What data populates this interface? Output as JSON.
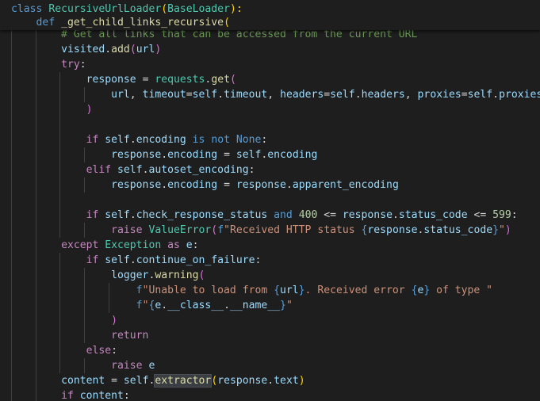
{
  "editor": {
    "sticky": [
      [
        [
          "kw",
          "class "
        ],
        [
          "cls",
          "RecursiveUrlLoader"
        ],
        [
          "yellow",
          "("
        ],
        [
          "cls",
          "BaseLoader"
        ],
        [
          "yellow",
          "):"
        ]
      ],
      [
        [
          "t",
          "    "
        ],
        [
          "kw",
          "def "
        ],
        [
          "fn",
          "_get_child_links_recursive"
        ],
        [
          "yellow",
          "("
        ]
      ]
    ],
    "lines": [
      [
        [
          "t",
          "        "
        ],
        [
          "cmt",
          "# Get all links that can be accessed from the current URL"
        ]
      ],
      [
        [
          "t",
          "        "
        ],
        [
          "var",
          "visited"
        ],
        [
          "t",
          "."
        ],
        [
          "fn",
          "add"
        ],
        [
          "paren",
          "("
        ],
        [
          "var",
          "url"
        ],
        [
          "paren",
          ")"
        ]
      ],
      [
        [
          "t",
          "        "
        ],
        [
          "ctrl",
          "try"
        ],
        [
          "t",
          ":"
        ]
      ],
      [
        [
          "t",
          "            "
        ],
        [
          "var",
          "response"
        ],
        [
          "t",
          " = "
        ],
        [
          "cls",
          "requests"
        ],
        [
          "t",
          "."
        ],
        [
          "fn",
          "get"
        ],
        [
          "paren",
          "("
        ]
      ],
      [
        [
          "t",
          "                "
        ],
        [
          "var",
          "url"
        ],
        [
          "t",
          ", "
        ],
        [
          "var",
          "timeout"
        ],
        [
          "t",
          "="
        ],
        [
          "var",
          "self"
        ],
        [
          "t",
          "."
        ],
        [
          "var",
          "timeout"
        ],
        [
          "t",
          ", "
        ],
        [
          "var",
          "headers"
        ],
        [
          "t",
          "="
        ],
        [
          "var",
          "self"
        ],
        [
          "t",
          "."
        ],
        [
          "var",
          "headers"
        ],
        [
          "t",
          ", "
        ],
        [
          "var",
          "proxies"
        ],
        [
          "t",
          "="
        ],
        [
          "var",
          "self"
        ],
        [
          "t",
          "."
        ],
        [
          "var",
          "proxies"
        ]
      ],
      [
        [
          "t",
          "            "
        ],
        [
          "paren",
          ")"
        ]
      ],
      [],
      [
        [
          "t",
          "            "
        ],
        [
          "ctrl",
          "if "
        ],
        [
          "var",
          "self"
        ],
        [
          "t",
          "."
        ],
        [
          "var",
          "encoding"
        ],
        [
          "t",
          " "
        ],
        [
          "kw",
          "is not"
        ],
        [
          "t",
          " "
        ],
        [
          "kw",
          "None"
        ],
        [
          "t",
          ":"
        ]
      ],
      [
        [
          "t",
          "                "
        ],
        [
          "var",
          "response"
        ],
        [
          "t",
          "."
        ],
        [
          "var",
          "encoding"
        ],
        [
          "t",
          " = "
        ],
        [
          "var",
          "self"
        ],
        [
          "t",
          "."
        ],
        [
          "var",
          "encoding"
        ]
      ],
      [
        [
          "t",
          "            "
        ],
        [
          "ctrl",
          "elif "
        ],
        [
          "var",
          "self"
        ],
        [
          "t",
          "."
        ],
        [
          "var",
          "autoset_encoding"
        ],
        [
          "t",
          ":"
        ]
      ],
      [
        [
          "t",
          "                "
        ],
        [
          "var",
          "response"
        ],
        [
          "t",
          "."
        ],
        [
          "var",
          "encoding"
        ],
        [
          "t",
          " = "
        ],
        [
          "var",
          "response"
        ],
        [
          "t",
          "."
        ],
        [
          "var",
          "apparent_encoding"
        ]
      ],
      [],
      [
        [
          "t",
          "            "
        ],
        [
          "ctrl",
          "if "
        ],
        [
          "var",
          "self"
        ],
        [
          "t",
          "."
        ],
        [
          "var",
          "check_response_status"
        ],
        [
          "t",
          " "
        ],
        [
          "kw",
          "and"
        ],
        [
          "t",
          " "
        ],
        [
          "num",
          "400"
        ],
        [
          "t",
          " <= "
        ],
        [
          "var",
          "response"
        ],
        [
          "t",
          "."
        ],
        [
          "var",
          "status_code"
        ],
        [
          "t",
          " <= "
        ],
        [
          "num",
          "599"
        ],
        [
          "t",
          ":"
        ]
      ],
      [
        [
          "t",
          "                "
        ],
        [
          "ctrl",
          "raise "
        ],
        [
          "cls",
          "ValueError"
        ],
        [
          "paren",
          "("
        ],
        [
          "kw",
          "f"
        ],
        [
          "str",
          "\"Received HTTP status "
        ],
        [
          "brace",
          "{"
        ],
        [
          "var",
          "response"
        ],
        [
          "t",
          "."
        ],
        [
          "var",
          "status_code"
        ],
        [
          "brace",
          "}"
        ],
        [
          "str",
          "\""
        ],
        [
          "paren",
          ")"
        ]
      ],
      [
        [
          "t",
          "        "
        ],
        [
          "ctrl",
          "except "
        ],
        [
          "cls",
          "Exception"
        ],
        [
          "t",
          " "
        ],
        [
          "ctrl",
          "as "
        ],
        [
          "var",
          "e"
        ],
        [
          "t",
          ":"
        ]
      ],
      [
        [
          "t",
          "            "
        ],
        [
          "ctrl",
          "if "
        ],
        [
          "var",
          "self"
        ],
        [
          "t",
          "."
        ],
        [
          "var",
          "continue_on_failure"
        ],
        [
          "t",
          ":"
        ]
      ],
      [
        [
          "t",
          "                "
        ],
        [
          "var",
          "logger"
        ],
        [
          "t",
          "."
        ],
        [
          "fn",
          "warning"
        ],
        [
          "paren",
          "("
        ]
      ],
      [
        [
          "t",
          "                    "
        ],
        [
          "kw",
          "f"
        ],
        [
          "str",
          "\"Unable to load from "
        ],
        [
          "brace",
          "{"
        ],
        [
          "var",
          "url"
        ],
        [
          "brace",
          "}"
        ],
        [
          "str",
          ". Received error "
        ],
        [
          "brace",
          "{"
        ],
        [
          "var",
          "e"
        ],
        [
          "brace",
          "}"
        ],
        [
          "str",
          " of type \""
        ]
      ],
      [
        [
          "t",
          "                    "
        ],
        [
          "kw",
          "f"
        ],
        [
          "str",
          "\""
        ],
        [
          "brace",
          "{"
        ],
        [
          "var",
          "e"
        ],
        [
          "t",
          "."
        ],
        [
          "var",
          "__class__"
        ],
        [
          "t",
          "."
        ],
        [
          "var",
          "__name__"
        ],
        [
          "brace",
          "}"
        ],
        [
          "str",
          "\""
        ]
      ],
      [
        [
          "t",
          "                "
        ],
        [
          "paren",
          ")"
        ]
      ],
      [
        [
          "t",
          "                "
        ],
        [
          "ctrl",
          "return"
        ]
      ],
      [
        [
          "t",
          "            "
        ],
        [
          "ctrl",
          "else"
        ],
        [
          "t",
          ":"
        ]
      ],
      [
        [
          "t",
          "                "
        ],
        [
          "ctrl",
          "raise "
        ],
        [
          "var",
          "e"
        ]
      ],
      [
        [
          "t",
          "        "
        ],
        [
          "var",
          "content"
        ],
        [
          "t",
          " = "
        ],
        [
          "var",
          "self"
        ],
        [
          "t",
          "."
        ],
        [
          "fn",
          "extractor",
          "hl"
        ],
        [
          "yellow",
          "("
        ],
        [
          "var",
          "response"
        ],
        [
          "t",
          "."
        ],
        [
          "var",
          "text"
        ],
        [
          "yellow",
          ")"
        ]
      ],
      [
        [
          "t",
          "        "
        ],
        [
          "ctrl",
          "if "
        ],
        [
          "var",
          "content"
        ],
        [
          "t",
          ":"
        ]
      ]
    ]
  }
}
